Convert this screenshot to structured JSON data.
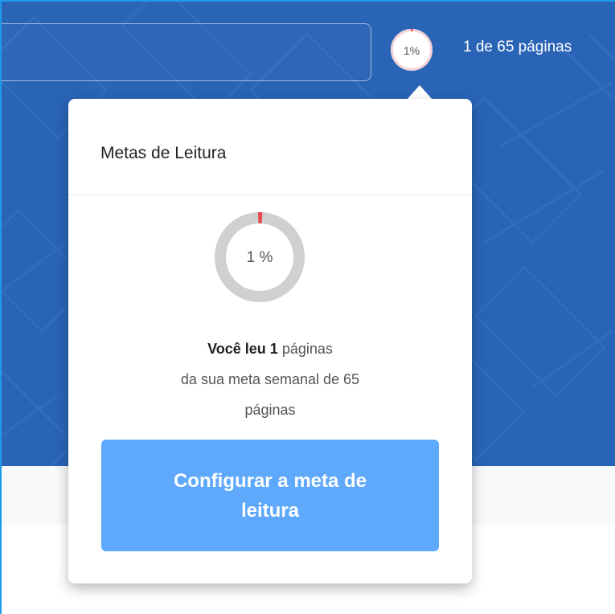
{
  "header": {
    "progress_percent_label": "1%",
    "pages_status": "1 de 65 páginas",
    "progress_fraction": 0.0154
  },
  "popover": {
    "title": "Metas de Leitura",
    "progress_percent_label": "1 %",
    "summary_bold": "Você leu 1",
    "summary_rest_line1": " páginas",
    "summary_line2": "da sua meta semanal de 65",
    "summary_line3": "páginas",
    "button_label": "Configurar a meta de leitura"
  },
  "colors": {
    "banner": "#2a64b6",
    "progress_accent": "#e8464f",
    "ring_track": "#d0d0d0",
    "button": "#5ea9fc"
  }
}
